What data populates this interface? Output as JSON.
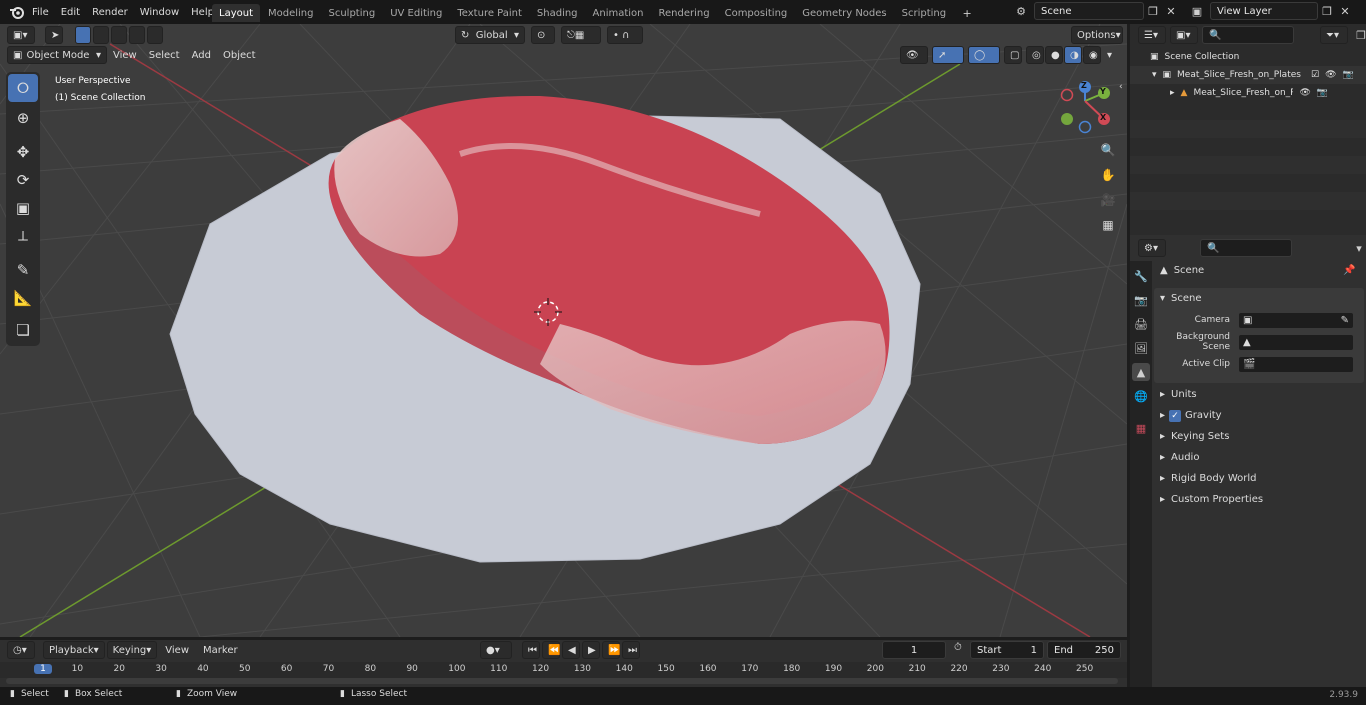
{
  "topbar": {
    "menus": [
      "File",
      "Edit",
      "Render",
      "Window",
      "Help"
    ],
    "workspace_tabs": [
      "Layout",
      "Modeling",
      "Sculpting",
      "UV Editing",
      "Texture Paint",
      "Shading",
      "Animation",
      "Rendering",
      "Compositing",
      "Geometry Nodes",
      "Scripting"
    ],
    "active_tab": "Layout",
    "add_tab": "+",
    "scene_name": "Scene",
    "view_layer_name": "View Layer"
  },
  "viewport": {
    "mode": "Object Mode",
    "menus": [
      "View",
      "Select",
      "Add",
      "Object"
    ],
    "transform_orientation": "Global",
    "options_label": "Options",
    "overlay_line1": "User Perspective",
    "overlay_line2": "(1) Scene Collection",
    "gizmo": {
      "x": "X",
      "y": "Y",
      "z": "Z"
    }
  },
  "outliner": {
    "root": "Scene Collection",
    "items": [
      "Meat_Slice_Fresh_on_Plates",
      "Meat_Slice_Fresh_on_Pla"
    ]
  },
  "properties": {
    "context_title": "Scene",
    "panel_title": "Scene",
    "fields": [
      {
        "label": "Camera"
      },
      {
        "label": "Background Scene"
      },
      {
        "label": "Active Clip"
      }
    ],
    "sections": [
      "Units",
      "Gravity",
      "Keying Sets",
      "Audio",
      "Rigid Body World",
      "Custom Properties"
    ],
    "gravity_checked": true
  },
  "timeline": {
    "menus": [
      "Playback",
      "Keying",
      "View",
      "Marker"
    ],
    "current_frame": "1",
    "start_label": "Start",
    "start_value": "1",
    "end_label": "End",
    "end_value": "250",
    "ruler": [
      "1",
      "10",
      "20",
      "30",
      "40",
      "50",
      "60",
      "70",
      "80",
      "90",
      "100",
      "110",
      "120",
      "130",
      "140",
      "150",
      "160",
      "170",
      "180",
      "190",
      "200",
      "210",
      "220",
      "230",
      "240",
      "250"
    ]
  },
  "statusbar": {
    "items": [
      "Select",
      "Box Select",
      "Zoom View",
      "Lasso Select"
    ],
    "version": "2.93.9"
  },
  "colors": {
    "accent": "#4772b3",
    "x_axis": "#d04a55",
    "y_axis": "#7ab23e",
    "z_axis": "#4a84d4",
    "meat": "#c9404f",
    "plate": "#c7cbd5"
  }
}
